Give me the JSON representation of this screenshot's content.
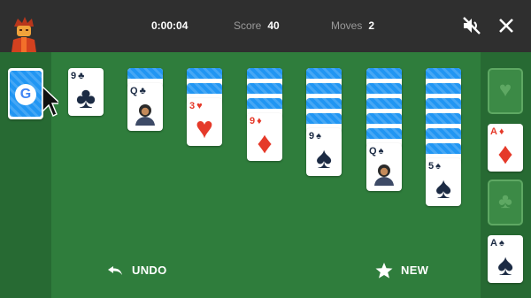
{
  "header": {
    "timer": "0:00:04",
    "score_label": "Score",
    "score_value": "40",
    "moves_label": "Moves",
    "moves_value": "2",
    "mute_icon": "volume-off-icon",
    "close_icon": "close-icon"
  },
  "stock": {
    "logo_letter": "G"
  },
  "tableau": [
    {
      "face_down": 0,
      "face_up": [
        {
          "rank": "9",
          "suit": "♣",
          "color": "black"
        }
      ]
    },
    {
      "face_down": 1,
      "face_up": [
        {
          "rank": "Q",
          "suit": "♣",
          "color": "black"
        }
      ]
    },
    {
      "face_down": 2,
      "face_up": [
        {
          "rank": "3",
          "suit": "♥",
          "color": "red"
        }
      ]
    },
    {
      "face_down": 3,
      "face_up": [
        {
          "rank": "9",
          "suit": "♦",
          "color": "red"
        }
      ]
    },
    {
      "face_down": 4,
      "face_up": [
        {
          "rank": "9",
          "suit": "♠",
          "color": "black"
        }
      ]
    },
    {
      "face_down": 5,
      "face_up": [
        {
          "rank": "Q",
          "suit": "♠",
          "color": "black"
        }
      ]
    },
    {
      "face_down": 6,
      "face_up": [
        {
          "rank": "5",
          "suit": "♠",
          "color": "black"
        }
      ]
    }
  ],
  "foundations": [
    {
      "empty": true,
      "suit": "♥"
    },
    {
      "empty": false,
      "rank": "A",
      "suit": "♦",
      "color": "red"
    },
    {
      "empty": true,
      "suit": "♣"
    },
    {
      "empty": false,
      "rank": "A",
      "suit": "♠",
      "color": "black"
    }
  ],
  "actions": {
    "undo_label": "UNDO",
    "new_label": "NEW"
  },
  "colors": {
    "felt": "#2f7d3c",
    "felt_dark": "#276a33",
    "topbar": "#2f2f2f",
    "card_back": "#2196f3",
    "red_suit": "#e53a2a",
    "black_suit": "#1c2b44"
  }
}
